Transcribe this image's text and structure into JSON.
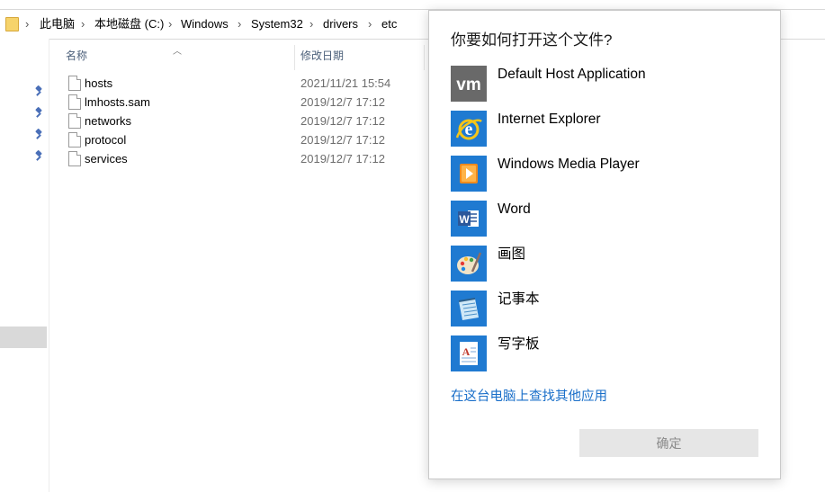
{
  "explorer": {
    "breadcrumbs": [
      "此电脑",
      "本地磁盘 (C:)",
      "Windows",
      "System32",
      "drivers",
      "etc"
    ],
    "columns": {
      "name": "名称",
      "modified": "修改日期"
    },
    "files": [
      {
        "name": "hosts",
        "modified": "2021/11/21 15:54"
      },
      {
        "name": "lmhosts.sam",
        "modified": "2019/12/7 17:12"
      },
      {
        "name": "networks",
        "modified": "2019/12/7 17:12"
      },
      {
        "name": "protocol",
        "modified": "2019/12/7 17:12"
      },
      {
        "name": "services",
        "modified": "2019/12/7 17:12"
      }
    ]
  },
  "dialog": {
    "title": "你要如何打开这个文件?",
    "apps": [
      {
        "label": "Default Host Application",
        "icon": "vmware-icon"
      },
      {
        "label": "Internet Explorer",
        "icon": "internet-explorer-icon"
      },
      {
        "label": "Windows Media Player",
        "icon": "media-player-icon"
      },
      {
        "label": "Word",
        "icon": "word-icon"
      },
      {
        "label": "画图",
        "icon": "paint-icon"
      },
      {
        "label": "记事本",
        "icon": "notepad-icon"
      },
      {
        "label": "写字板",
        "icon": "wordpad-icon"
      }
    ],
    "more_apps_link": "在这台电脑上查找其他应用",
    "ok_label": "确定"
  },
  "colors": {
    "accent": "#1f7ad1",
    "link": "#1a6fc9",
    "button_disabled": "#e6e6e6"
  }
}
